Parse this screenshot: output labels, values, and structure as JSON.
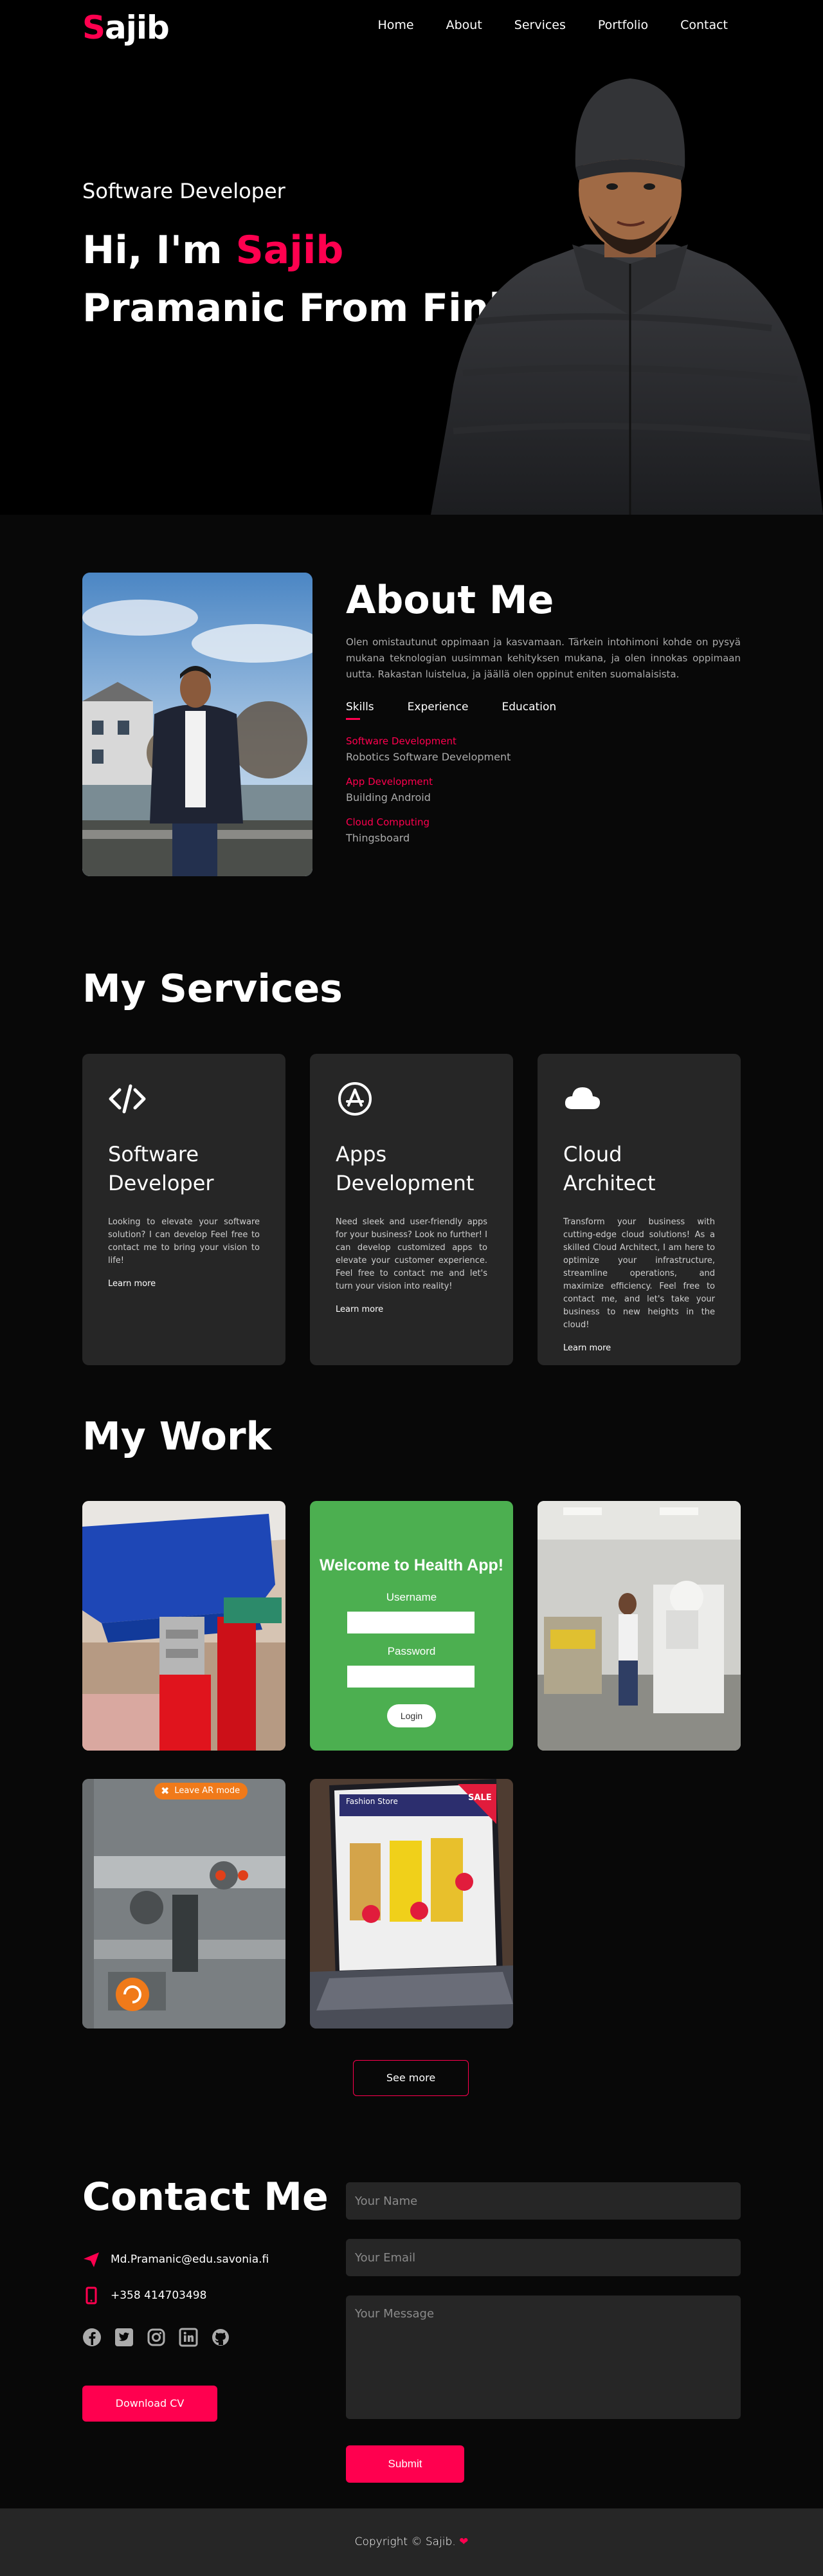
{
  "header": {
    "logo_first": "S",
    "logo_rest": "ajib",
    "nav": [
      "Home",
      "About",
      "Services",
      "Portfolio",
      "Contact"
    ]
  },
  "hero": {
    "subtitle": "Software Developer",
    "title_prefix": "Hi, I'm ",
    "title_highlight": "Sajib",
    "title_line2": "Pramanic From Finland"
  },
  "about": {
    "title": "About Me",
    "paragraph": "Olen omistautunut oppimaan ja kasvamaan. Tärkein intohimoni kohde on pysyä mukana teknologian uusimman kehityksen mukana, ja olen innokas oppimaan uutta. Rakastan luistelua, ja jäällä olen oppinut eniten suomalaisista.",
    "tabs": [
      "Skills",
      "Experience",
      "Education"
    ],
    "skills": [
      {
        "title": "Software Development",
        "detail": "Robotics Software Development"
      },
      {
        "title": "App Development",
        "detail": "Building Android"
      },
      {
        "title": "Cloud Computing",
        "detail": "Thingsboard"
      }
    ]
  },
  "services": {
    "title": "My Services",
    "items": [
      {
        "icon": "code-icon",
        "title1": "Software",
        "title2": "Developer",
        "text": "Looking to elevate your software solution? I can develop Feel free to contact me to bring your vision to life!",
        "link": "Learn more"
      },
      {
        "icon": "app-store-icon",
        "title1": "Apps",
        "title2": "Development",
        "text": "Need sleek and user-friendly apps for your business? Look no further! I can develop customized apps to elevate your customer experience. Feel free to contact me and let's turn your vision into reality!",
        "link": "Learn more"
      },
      {
        "icon": "cloud-icon",
        "title1": "Cloud",
        "title2": "Architect",
        "text": "Transform your business with cutting-edge cloud solutions! As a skilled Cloud Architect, I am here to optimize your infrastructure, streamline operations, and maximize efficiency. Feel free to contact me, and let's take your business to new heights in the cloud!",
        "link": "Learn more"
      }
    ]
  },
  "work": {
    "title": "My Work",
    "health_app": {
      "heading": "Welcome to Health App!",
      "username_label": "Username",
      "password_label": "Password",
      "login_label": "Login"
    },
    "ar_label": "Leave AR mode",
    "store_label": "Fashion Store",
    "sale_label": "SALE",
    "see_more": "See more"
  },
  "contact": {
    "title": "Contact Me",
    "email": "Md.Pramanic@edu.savonia.fi",
    "phone": "+358 414703498",
    "download_cv": "Download CV",
    "name_placeholder": "Your Name",
    "email_placeholder": "Your Email",
    "message_placeholder": "Your Message",
    "submit": "Submit"
  },
  "footer": {
    "text": "Copyright © Sajib."
  },
  "colors": {
    "accent": "#ff004f",
    "card": "#262626",
    "background": "#080808"
  }
}
